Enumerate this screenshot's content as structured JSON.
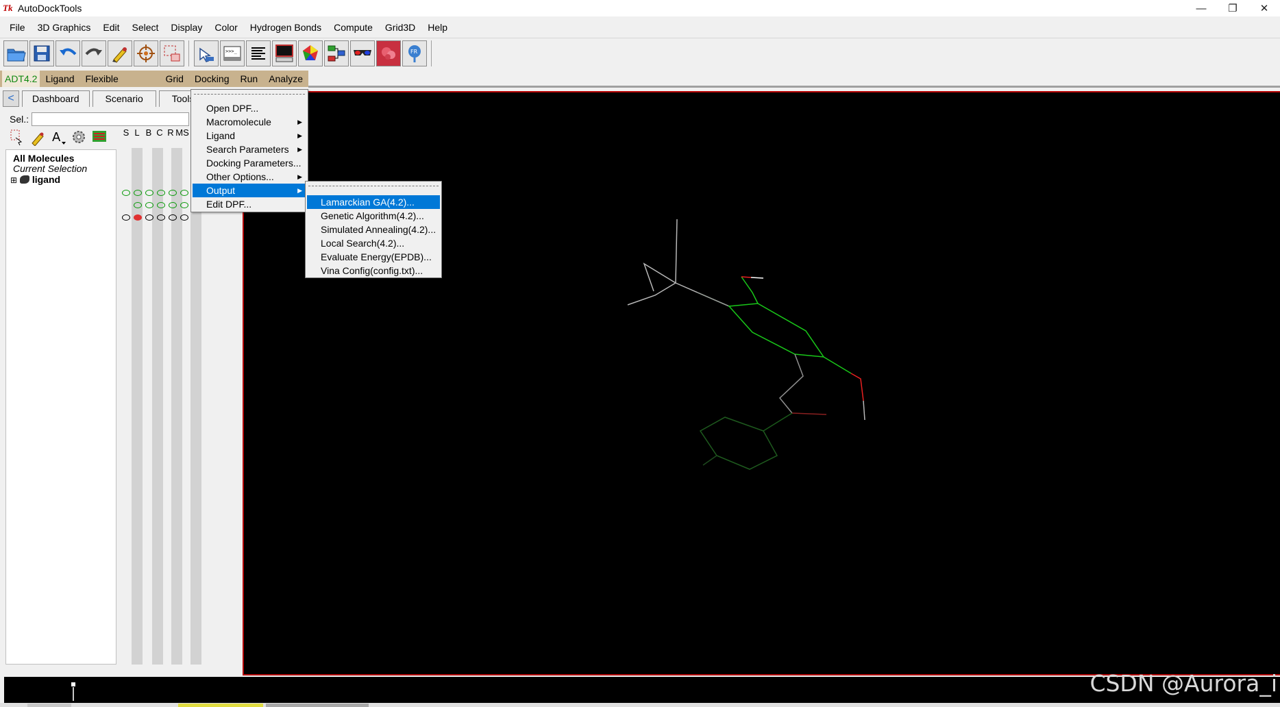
{
  "window": {
    "app_icon_text": "Tk",
    "title": "AutoDockTools",
    "controls": {
      "minimize": "—",
      "maximize": "❐",
      "close": "✕"
    }
  },
  "menubar": [
    "File",
    "3D Graphics",
    "Edit",
    "Select",
    "Display",
    "Color",
    "Hydrogen Bonds",
    "Compute",
    "Grid3D",
    "Help"
  ],
  "toolbar_icons": [
    "open-folder-icon",
    "save-disk-icon",
    "undo-arrow-icon",
    "redo-arrow-icon",
    "pencil-icon",
    "target-icon",
    "select-box-icon",
    "hand-pointer-icon",
    "python-shell-icon",
    "text-lines-icon",
    "monitor-icon",
    "color-sphere-icon",
    "network-icon",
    "3d-glasses-icon",
    "molecule-surface-icon",
    "pmv-logo-icon"
  ],
  "adt_menu": {
    "items": [
      "ADT4.2",
      "Ligand",
      "Flexible Residues",
      "Grid",
      "Docking",
      "Run",
      "Analyze"
    ],
    "active": "ADT4.2",
    "colors": {
      "bar": "#c8b28e",
      "active_text": "#118811"
    }
  },
  "left_panel": {
    "tabs": [
      "Dashboard",
      "Scenario",
      "Tools"
    ],
    "sel_label": "Sel.:",
    "sel_value": "",
    "column_headers": [
      "S",
      "L",
      "B",
      "C",
      "R",
      "MS"
    ],
    "tree": {
      "all_molecules": "All Molecules",
      "current_selection": "Current Selection",
      "ligand": "ligand",
      "expand": "⊞"
    }
  },
  "docking_menu": {
    "items": [
      {
        "label": "Open DPF...",
        "submenu": false
      },
      {
        "label": "Macromolecule",
        "submenu": true
      },
      {
        "label": "Ligand",
        "submenu": true
      },
      {
        "label": "Search Parameters",
        "submenu": true
      },
      {
        "label": "Docking Parameters...",
        "submenu": false
      },
      {
        "label": "Other Options...",
        "submenu": true
      },
      {
        "label": "Output",
        "submenu": true,
        "highlighted": true
      },
      {
        "label": "Edit DPF...",
        "submenu": false
      }
    ]
  },
  "output_submenu": {
    "items": [
      {
        "label": "Lamarckian GA(4.2)...",
        "highlighted": true
      },
      {
        "label": "Genetic Algorithm(4.2)..."
      },
      {
        "label": "Simulated Annealing(4.2)..."
      },
      {
        "label": "Local Search(4.2)..."
      },
      {
        "label": "Evaluate Energy(EPDB)..."
      },
      {
        "label": "Vina Config(config.txt)..."
      }
    ]
  },
  "watermark": "CSDN @Aurora_i",
  "colors": {
    "highlight": "#0078d7",
    "viewer_bg": "#000000",
    "viewer_border": "#b40000"
  }
}
